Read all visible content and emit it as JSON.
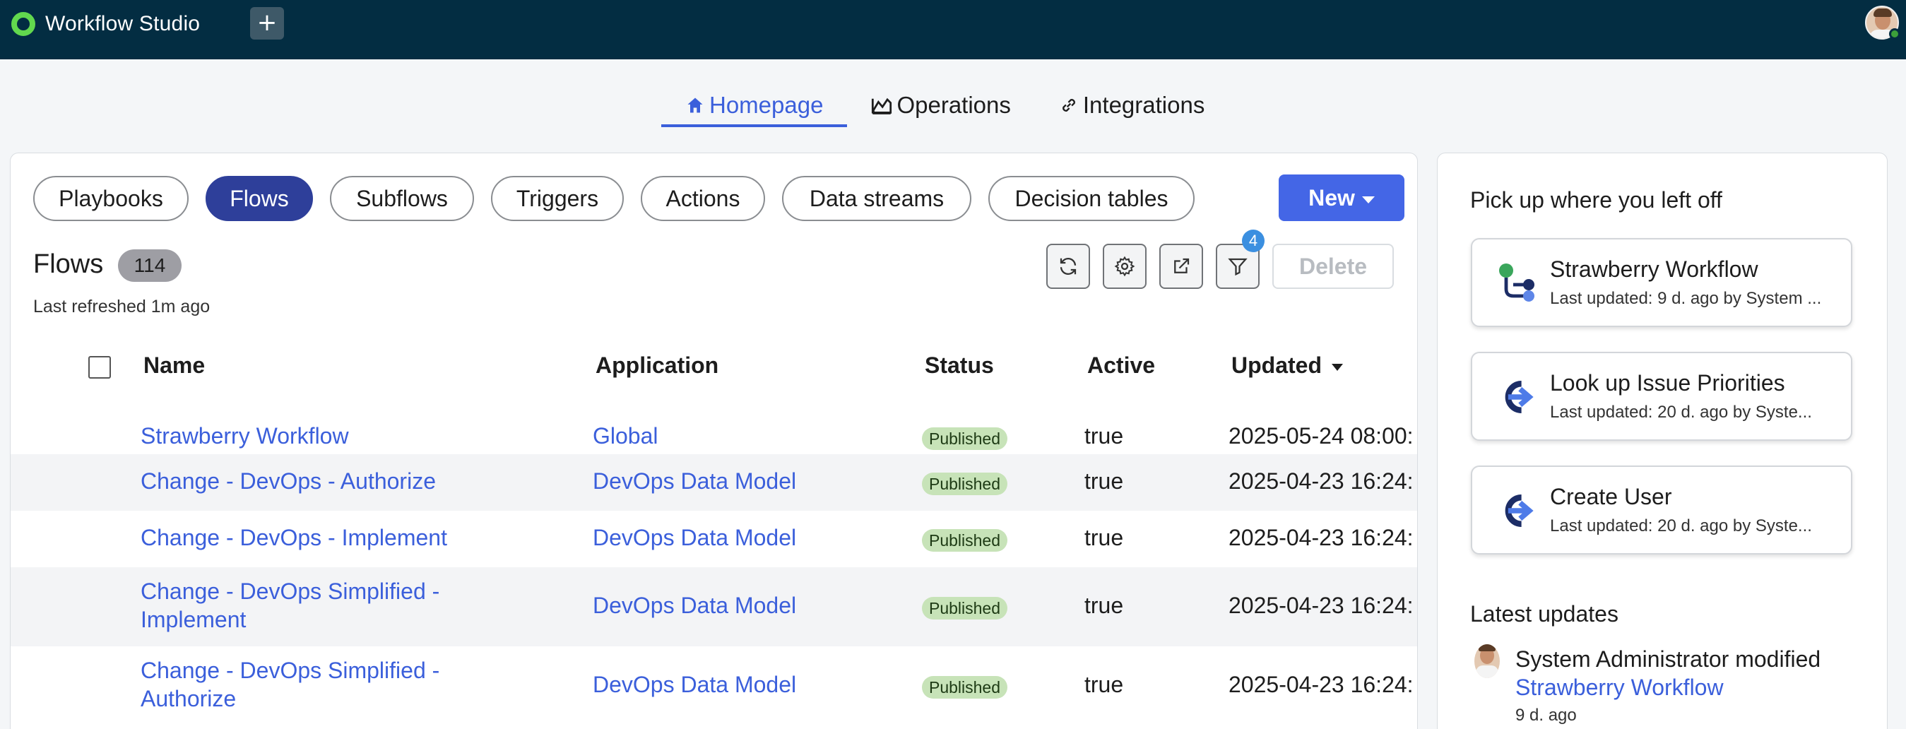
{
  "app": {
    "title": "Workflow Studio",
    "new_tab_symbol": "+"
  },
  "nav": {
    "tabs": [
      {
        "label": "Homepage",
        "icon": "home-icon",
        "active": true
      },
      {
        "label": "Operations",
        "icon": "chart-icon",
        "active": false
      },
      {
        "label": "Integrations",
        "icon": "link-icon",
        "active": false
      }
    ]
  },
  "filters": {
    "pills": [
      "Playbooks",
      "Flows",
      "Subflows",
      "Triggers",
      "Actions",
      "Data streams",
      "Decision tables"
    ],
    "active": "Flows",
    "new_button": "New"
  },
  "list": {
    "title": "Flows",
    "count": "114",
    "refreshed": "Last refreshed 1m ago",
    "filter_count": "4",
    "delete_label": "Delete",
    "columns": {
      "name": "Name",
      "application": "Application",
      "status": "Status",
      "active": "Active",
      "updated": "Updated"
    },
    "rows": [
      {
        "name_line1": "Strawberry Workflow",
        "name_line2": "",
        "application": "Global",
        "status": "Published",
        "active": "true",
        "updated": "2025-05-24 08:00:"
      },
      {
        "name_line1": "Change - DevOps - Authorize",
        "name_line2": "",
        "application": "DevOps Data Model",
        "status": "Published",
        "active": "true",
        "updated": "2025-04-23 16:24:"
      },
      {
        "name_line1": "Change - DevOps - Implement",
        "name_line2": "",
        "application": "DevOps Data Model",
        "status": "Published",
        "active": "true",
        "updated": "2025-04-23 16:24:"
      },
      {
        "name_line1": "Change - DevOps Simplified -",
        "name_line2": "Implement",
        "application": "DevOps Data Model",
        "status": "Published",
        "active": "true",
        "updated": "2025-04-23 16:24:"
      },
      {
        "name_line1": "Change - DevOps Simplified -",
        "name_line2": "Authorize",
        "application": "DevOps Data Model",
        "status": "Published",
        "active": "true",
        "updated": "2025-04-23 16:24:"
      }
    ]
  },
  "side": {
    "resume_heading": "Pick up where you left off",
    "recent": [
      {
        "title": "Strawberry Workflow",
        "subtitle": "Last updated: 9 d. ago by System ...",
        "icon": "flow-icon"
      },
      {
        "title": "Look up Issue Priorities",
        "subtitle": "Last updated: 20 d. ago by Syste...",
        "icon": "action-icon"
      },
      {
        "title": "Create User",
        "subtitle": "Last updated: 20 d. ago by Syste...",
        "icon": "action-icon"
      }
    ],
    "updates_heading": "Latest updates",
    "update": {
      "text": "System Administrator modified",
      "link": "Strawberry Workflow",
      "time": "9 d. ago"
    }
  },
  "colors": {
    "topbar": "#032d42",
    "accent": "#3b5fdb",
    "active_pill": "#2e3f9a",
    "new_button": "#4466e6",
    "published": "#c7e3b8",
    "logo": "#62d84e"
  }
}
